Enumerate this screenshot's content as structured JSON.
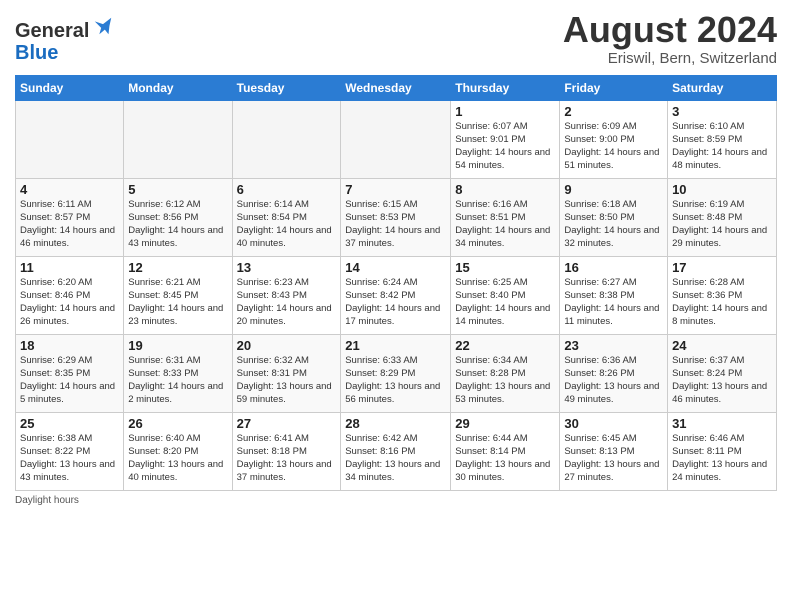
{
  "header": {
    "logo_line1": "General",
    "logo_line2": "Blue",
    "month_title": "August 2024",
    "subtitle": "Eriswil, Bern, Switzerland"
  },
  "weekdays": [
    "Sunday",
    "Monday",
    "Tuesday",
    "Wednesday",
    "Thursday",
    "Friday",
    "Saturday"
  ],
  "weeks": [
    [
      {
        "day": "",
        "empty": true
      },
      {
        "day": "",
        "empty": true
      },
      {
        "day": "",
        "empty": true
      },
      {
        "day": "",
        "empty": true
      },
      {
        "day": "1",
        "sunrise": "6:07 AM",
        "sunset": "9:01 PM",
        "daylight": "14 hours and 54 minutes."
      },
      {
        "day": "2",
        "sunrise": "6:09 AM",
        "sunset": "9:00 PM",
        "daylight": "14 hours and 51 minutes."
      },
      {
        "day": "3",
        "sunrise": "6:10 AM",
        "sunset": "8:59 PM",
        "daylight": "14 hours and 48 minutes."
      }
    ],
    [
      {
        "day": "4",
        "sunrise": "6:11 AM",
        "sunset": "8:57 PM",
        "daylight": "14 hours and 46 minutes."
      },
      {
        "day": "5",
        "sunrise": "6:12 AM",
        "sunset": "8:56 PM",
        "daylight": "14 hours and 43 minutes."
      },
      {
        "day": "6",
        "sunrise": "6:14 AM",
        "sunset": "8:54 PM",
        "daylight": "14 hours and 40 minutes."
      },
      {
        "day": "7",
        "sunrise": "6:15 AM",
        "sunset": "8:53 PM",
        "daylight": "14 hours and 37 minutes."
      },
      {
        "day": "8",
        "sunrise": "6:16 AM",
        "sunset": "8:51 PM",
        "daylight": "14 hours and 34 minutes."
      },
      {
        "day": "9",
        "sunrise": "6:18 AM",
        "sunset": "8:50 PM",
        "daylight": "14 hours and 32 minutes."
      },
      {
        "day": "10",
        "sunrise": "6:19 AM",
        "sunset": "8:48 PM",
        "daylight": "14 hours and 29 minutes."
      }
    ],
    [
      {
        "day": "11",
        "sunrise": "6:20 AM",
        "sunset": "8:46 PM",
        "daylight": "14 hours and 26 minutes."
      },
      {
        "day": "12",
        "sunrise": "6:21 AM",
        "sunset": "8:45 PM",
        "daylight": "14 hours and 23 minutes."
      },
      {
        "day": "13",
        "sunrise": "6:23 AM",
        "sunset": "8:43 PM",
        "daylight": "14 hours and 20 minutes."
      },
      {
        "day": "14",
        "sunrise": "6:24 AM",
        "sunset": "8:42 PM",
        "daylight": "14 hours and 17 minutes."
      },
      {
        "day": "15",
        "sunrise": "6:25 AM",
        "sunset": "8:40 PM",
        "daylight": "14 hours and 14 minutes."
      },
      {
        "day": "16",
        "sunrise": "6:27 AM",
        "sunset": "8:38 PM",
        "daylight": "14 hours and 11 minutes."
      },
      {
        "day": "17",
        "sunrise": "6:28 AM",
        "sunset": "8:36 PM",
        "daylight": "14 hours and 8 minutes."
      }
    ],
    [
      {
        "day": "18",
        "sunrise": "6:29 AM",
        "sunset": "8:35 PM",
        "daylight": "14 hours and 5 minutes."
      },
      {
        "day": "19",
        "sunrise": "6:31 AM",
        "sunset": "8:33 PM",
        "daylight": "14 hours and 2 minutes."
      },
      {
        "day": "20",
        "sunrise": "6:32 AM",
        "sunset": "8:31 PM",
        "daylight": "13 hours and 59 minutes."
      },
      {
        "day": "21",
        "sunrise": "6:33 AM",
        "sunset": "8:29 PM",
        "daylight": "13 hours and 56 minutes."
      },
      {
        "day": "22",
        "sunrise": "6:34 AM",
        "sunset": "8:28 PM",
        "daylight": "13 hours and 53 minutes."
      },
      {
        "day": "23",
        "sunrise": "6:36 AM",
        "sunset": "8:26 PM",
        "daylight": "13 hours and 49 minutes."
      },
      {
        "day": "24",
        "sunrise": "6:37 AM",
        "sunset": "8:24 PM",
        "daylight": "13 hours and 46 minutes."
      }
    ],
    [
      {
        "day": "25",
        "sunrise": "6:38 AM",
        "sunset": "8:22 PM",
        "daylight": "13 hours and 43 minutes."
      },
      {
        "day": "26",
        "sunrise": "6:40 AM",
        "sunset": "8:20 PM",
        "daylight": "13 hours and 40 minutes."
      },
      {
        "day": "27",
        "sunrise": "6:41 AM",
        "sunset": "8:18 PM",
        "daylight": "13 hours and 37 minutes."
      },
      {
        "day": "28",
        "sunrise": "6:42 AM",
        "sunset": "8:16 PM",
        "daylight": "13 hours and 34 minutes."
      },
      {
        "day": "29",
        "sunrise": "6:44 AM",
        "sunset": "8:14 PM",
        "daylight": "13 hours and 30 minutes."
      },
      {
        "day": "30",
        "sunrise": "6:45 AM",
        "sunset": "8:13 PM",
        "daylight": "13 hours and 27 minutes."
      },
      {
        "day": "31",
        "sunrise": "6:46 AM",
        "sunset": "8:11 PM",
        "daylight": "13 hours and 24 minutes."
      }
    ]
  ],
  "footer": {
    "note": "Daylight hours"
  }
}
